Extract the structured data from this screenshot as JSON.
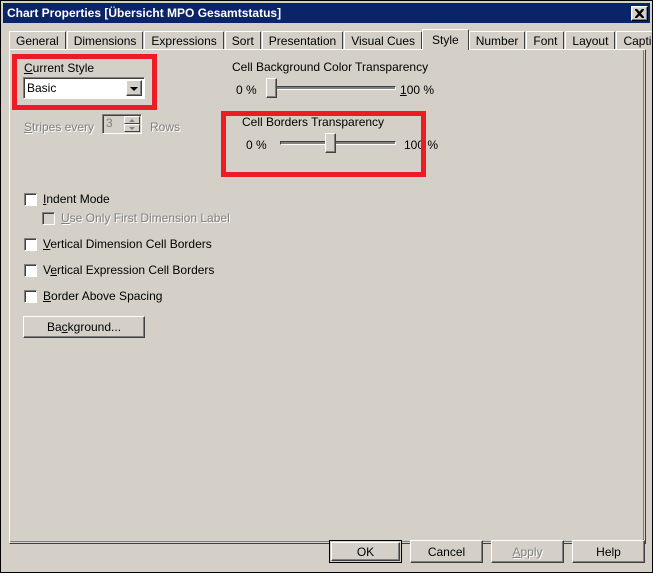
{
  "window": {
    "title": "Chart Properties [Übersicht MPO Gesamtstatus]",
    "close_icon": "close-icon",
    "titlebar_color": "#0a246a",
    "face_color": "#d4d0c8",
    "annotation_color": "#ed1c24"
  },
  "tabs": [
    {
      "label": "General",
      "active": false
    },
    {
      "label": "Dimensions",
      "active": false
    },
    {
      "label": "Expressions",
      "active": false
    },
    {
      "label": "Sort",
      "active": false
    },
    {
      "label": "Presentation",
      "active": false
    },
    {
      "label": "Visual Cues",
      "active": false
    },
    {
      "label": "Style",
      "active": true
    },
    {
      "label": "Number",
      "active": false
    },
    {
      "label": "Font",
      "active": false
    },
    {
      "label": "Layout",
      "active": false
    },
    {
      "label": "Caption",
      "active": false
    }
  ],
  "style_tab": {
    "current_style": {
      "label": "Current Style",
      "value": "Basic",
      "dropdown_icon": "chevron-down-icon"
    },
    "stripes": {
      "label_before": "Stripes every",
      "value": "3",
      "label_after": "Rows",
      "enabled": false
    },
    "sliders": [
      {
        "name": "cell-background-color-transparency",
        "label": "Cell Background Color Transparency",
        "min_label": "0 %",
        "max_label": "100 %",
        "value_percent": 0
      },
      {
        "name": "cell-borders-transparency",
        "label": "Cell Borders Transparency",
        "min_label": "0 %",
        "max_label": "100 %",
        "value_percent": 45
      }
    ],
    "checkboxes": [
      {
        "label": "Indent Mode",
        "checked": false,
        "enabled": true,
        "indented": false
      },
      {
        "label": "Use Only First Dimension Label",
        "checked": false,
        "enabled": false,
        "indented": true
      },
      {
        "label": "Vertical Dimension Cell Borders",
        "checked": false,
        "enabled": true,
        "indented": false
      },
      {
        "label": "Vertical Expression Cell Borders",
        "checked": false,
        "enabled": true,
        "indented": false
      },
      {
        "label": "Border Above Spacing",
        "checked": false,
        "enabled": true,
        "indented": false
      }
    ],
    "background_button": "Background..."
  },
  "footer_buttons": [
    {
      "label": "OK",
      "enabled": true,
      "default": true
    },
    {
      "label": "Cancel",
      "enabled": true,
      "default": false
    },
    {
      "label": "Apply",
      "enabled": false,
      "default": false
    },
    {
      "label": "Help",
      "enabled": true,
      "default": false
    }
  ]
}
